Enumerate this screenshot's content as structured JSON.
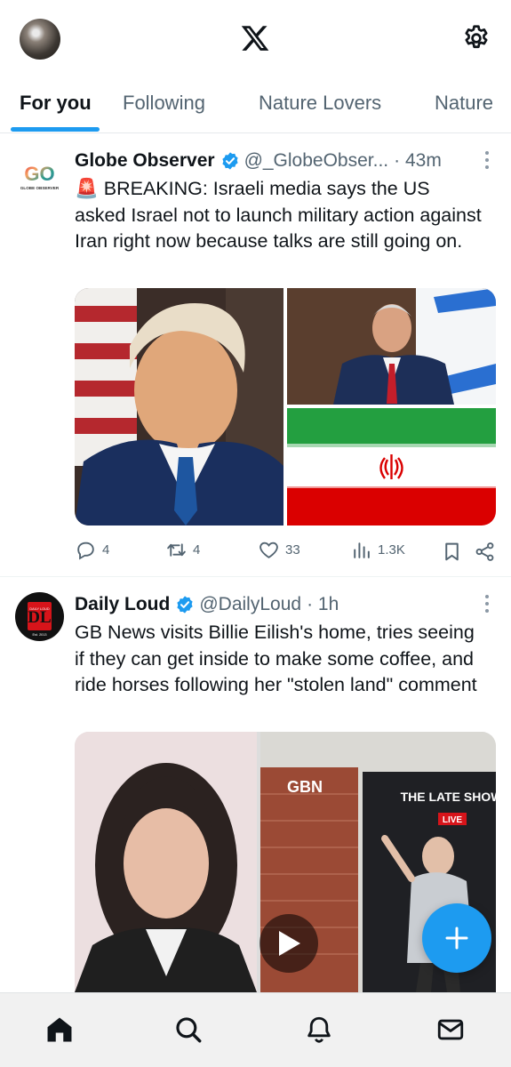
{
  "header": {
    "avatar_icon": "profile-avatar",
    "logo_icon": "x-logo",
    "settings_icon": "gear-icon"
  },
  "tabs": [
    {
      "label": "For you",
      "active": true
    },
    {
      "label": "Following",
      "active": false
    },
    {
      "label": "Nature Lovers",
      "active": false
    },
    {
      "label": "Nature",
      "active": false
    }
  ],
  "posts": [
    {
      "author": "Globe Observer",
      "handle": "@_GlobeObser...",
      "time": "· 43m",
      "avatar_text": "GO",
      "avatar_subtext": "GLOBE OBSERVER",
      "text": "🚨 BREAKING: Israeli media says the US asked Israel not to launch military action against Iran right now because talks are still going on.",
      "replies": "4",
      "reposts": "4",
      "likes": "33",
      "views": "1.3K"
    },
    {
      "author": "Daily Loud",
      "handle": "@DailyLoud",
      "time": "· 1h",
      "avatar_text": "DL",
      "avatar_subtext": "DAILY LOUD",
      "avatar_est": "Est. 2013",
      "text": "GB News visits Billie Eilish's home, tries seeing if they can get inside to make some coffee, and ride horses following her \"stolen land\" comment",
      "media_badge_left": "GBN",
      "media_badge_right": "THE LATE SHOW",
      "media_live": "LIVE"
    }
  ],
  "colors": {
    "accent": "#1d9bf0",
    "secondary_text": "#536471",
    "primary_text": "#0f1419"
  },
  "bottom_nav": [
    "home-icon",
    "search-icon",
    "bell-icon",
    "mail-icon"
  ]
}
